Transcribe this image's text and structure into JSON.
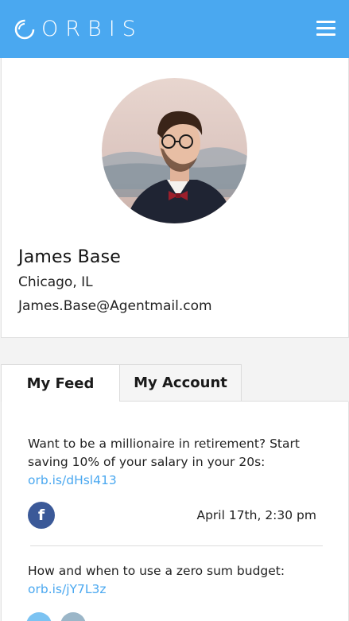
{
  "header": {
    "brand": "ORBIS",
    "menu_icon": "hamburger-menu-icon",
    "background": "#4aa8f0"
  },
  "profile": {
    "name": "James Base",
    "location": "Chicago, IL",
    "email": "James.Base@Agentmail.com"
  },
  "tabs": [
    {
      "label": "My Feed",
      "active": true
    },
    {
      "label": "My Account",
      "active": false
    }
  ],
  "feed": [
    {
      "text": "Want to be a millionaire in retirement? Start saving 10% of your salary in your 20s: ",
      "link": "orb.is/dHsl413",
      "source_icon": "facebook-icon",
      "time": "April 17th, 2:30 pm"
    },
    {
      "text": "How and when to use a zero sum budget: ",
      "link": "orb.is/jY7L3z",
      "source_icons": [
        "twitter-icon",
        "linkedin-icon"
      ]
    }
  ],
  "colors": {
    "accent": "#4aa8f0",
    "facebook": "#3b5998",
    "link": "#4aa8f0"
  }
}
